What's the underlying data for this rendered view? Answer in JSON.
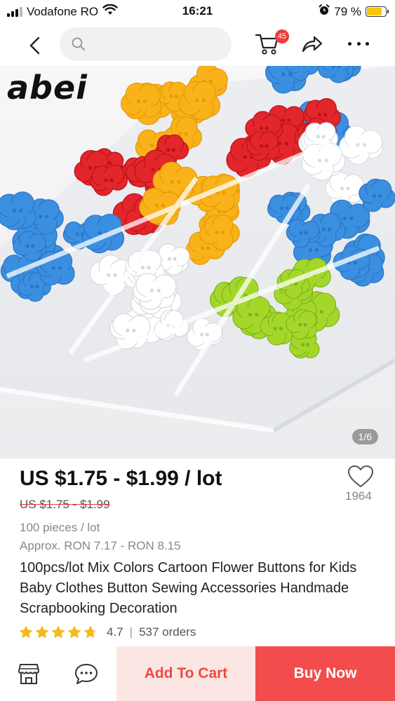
{
  "status_bar": {
    "carrier": "Vodafone RO",
    "time": "16:21",
    "battery_percent": "79 %",
    "battery_level": 0.79
  },
  "nav": {
    "back_icon": "chevron-left-icon",
    "search_placeholder": "",
    "cart_badge": "45",
    "share_icon": "share-arrow-icon",
    "more_icon": "more-dots-icon"
  },
  "product": {
    "brand_logo": "abei",
    "image_counter": "1/6",
    "price_range": "US $1.75 - $1.99 / lot",
    "original_price": "US $1.75 - $1.99",
    "wishlist_count": "1964",
    "pieces_per_lot": "100 pieces / lot",
    "approx_price": "Approx. RON 7.17 - RON 8.15",
    "title": "100pcs/lot Mix Colors Cartoon Flower Buttons for Kids Baby Clothes Button Sewing Accessories Handmade Scrapbooking Decoration",
    "rating": "4.7",
    "rating_value": 4.7,
    "rating_max": 5,
    "orders": "537 orders"
  },
  "bottom_bar": {
    "add_to_cart": "Add To Cart",
    "buy_now": "Buy Now"
  },
  "colors": {
    "accent_red": "#f24c4c",
    "cart_light": "#fce6e4",
    "star": "#f6b81a",
    "battery": "#f6c70a",
    "badge": "#f03b3b"
  }
}
